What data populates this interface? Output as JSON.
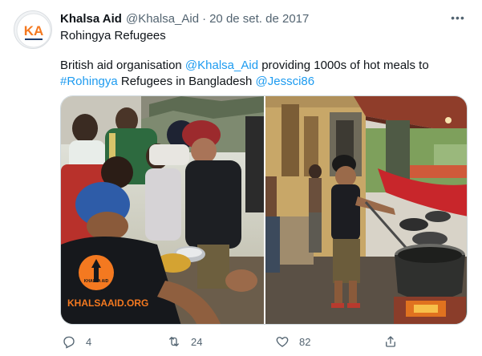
{
  "tweet": {
    "author_name": "Khalsa Aid",
    "handle": "@Khalsa_Aid",
    "separator": "·",
    "date": "20 de set. de 2017",
    "avatar_text": "KA",
    "title": "Rohingya Refugees",
    "body_prefix": "British aid organisation ",
    "mention_1": "@Khalsa_Aid",
    "body_middle": " providing 1000s of hot meals to",
    "hashtag": "#Rohingya",
    "body_suffix": " Refugees in Bangladesh ",
    "mention_2": "@Jessci86"
  },
  "media": {
    "photo_left_shirt_text": "KHALSAAID.ORG",
    "photo_left_logo_text": "KHALSA AID"
  },
  "actions": {
    "reply_count": "4",
    "retweet_count": "24",
    "like_count": "82"
  },
  "colors": {
    "link": "#1d9bf0",
    "secondary_text": "#536471",
    "primary_text": "#0f1419",
    "brand_orange": "#f47920"
  }
}
